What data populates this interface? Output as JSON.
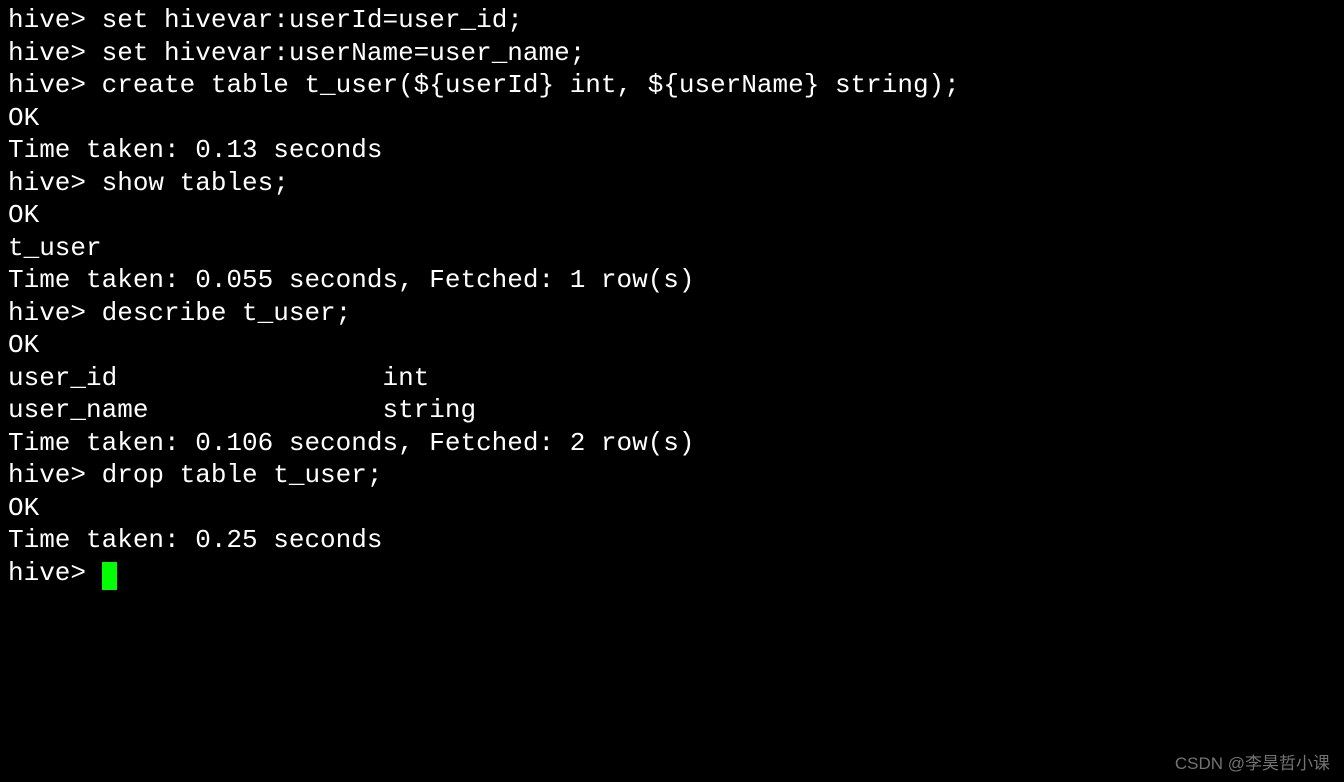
{
  "terminal": {
    "prompt": "hive> ",
    "lines": [
      {
        "type": "command",
        "text": "set hivevar:userId=user_id;"
      },
      {
        "type": "command",
        "text": "set hivevar:userName=user_name;"
      },
      {
        "type": "command",
        "text": "create table t_user(${userId} int, ${userName} string);"
      },
      {
        "type": "output",
        "text": "OK"
      },
      {
        "type": "output",
        "text": "Time taken: 0.13 seconds"
      },
      {
        "type": "command",
        "text": "show tables;"
      },
      {
        "type": "output",
        "text": "OK"
      },
      {
        "type": "output",
        "text": "t_user"
      },
      {
        "type": "output",
        "text": "Time taken: 0.055 seconds, Fetched: 1 row(s)"
      },
      {
        "type": "command",
        "text": "describe t_user;"
      },
      {
        "type": "output",
        "text": "OK"
      },
      {
        "type": "output",
        "text": "user_id             \tint"
      },
      {
        "type": "output",
        "text": "user_name           \tstring"
      },
      {
        "type": "output",
        "text": "Time taken: 0.106 seconds, Fetched: 2 row(s)"
      },
      {
        "type": "command",
        "text": "drop table t_user;"
      },
      {
        "type": "output",
        "text": "OK"
      },
      {
        "type": "output",
        "text": "Time taken: 0.25 seconds"
      },
      {
        "type": "prompt-cursor",
        "text": ""
      }
    ]
  },
  "watermark": "CSDN @李昊哲小课"
}
